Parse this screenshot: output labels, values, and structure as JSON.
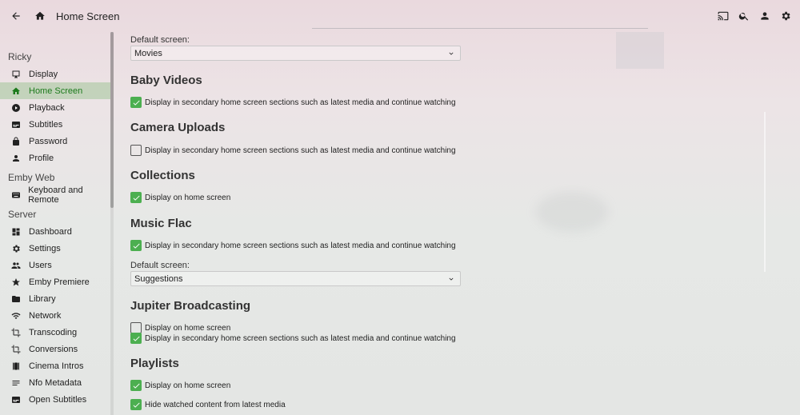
{
  "header": {
    "title": "Home Screen",
    "back_icon": "arrow-left-icon",
    "home_icon": "home-icon",
    "right_icons": [
      "cast-icon",
      "search-icon",
      "user-icon",
      "settings-gear-icon"
    ]
  },
  "sidebar": {
    "sections": [
      {
        "title": "Ricky",
        "items": [
          {
            "label": "Display",
            "icon": "monitor-icon"
          },
          {
            "label": "Home Screen",
            "icon": "home-icon",
            "active": true
          },
          {
            "label": "Playback",
            "icon": "play-circle-icon"
          },
          {
            "label": "Subtitles",
            "icon": "subtitles-icon"
          },
          {
            "label": "Password",
            "icon": "lock-icon"
          },
          {
            "label": "Profile",
            "icon": "person-icon"
          }
        ]
      },
      {
        "title": "Emby Web",
        "items": [
          {
            "label": "Keyboard and Remote",
            "icon": "keyboard-icon"
          }
        ]
      },
      {
        "title": "Server",
        "items": [
          {
            "label": "Dashboard",
            "icon": "dashboard-icon"
          },
          {
            "label": "Settings",
            "icon": "gear-icon"
          },
          {
            "label": "Users",
            "icon": "people-icon"
          },
          {
            "label": "Emby Premiere",
            "icon": "star-icon"
          },
          {
            "label": "Library",
            "icon": "folder-icon"
          },
          {
            "label": "Network",
            "icon": "wifi-icon"
          },
          {
            "label": "Transcoding",
            "icon": "crop-icon"
          },
          {
            "label": "Conversions",
            "icon": "crop-icon"
          },
          {
            "label": "Cinema Intros",
            "icon": "film-icon"
          },
          {
            "label": "Nfo Metadata",
            "icon": "list-icon"
          },
          {
            "label": "Open Subtitles",
            "icon": "subtitles-icon"
          }
        ]
      }
    ]
  },
  "main": {
    "default_screen_label": "Default screen:",
    "default_screen_value": "Movies",
    "libraries": {
      "baby_videos": {
        "title": "Baby Videos",
        "opt1": "Display in secondary home screen sections such as latest media and continue watching",
        "opt1_checked": true
      },
      "camera_uploads": {
        "title": "Camera Uploads",
        "opt1": "Display in secondary home screen sections such as latest media and continue watching",
        "opt1_checked": false
      },
      "collections": {
        "title": "Collections",
        "opt1": "Display on home screen",
        "opt1_checked": true
      },
      "music_flac": {
        "title": "Music Flac",
        "opt1": "Display in secondary home screen sections such as latest media and continue watching",
        "opt1_checked": true,
        "default_label": "Default screen:",
        "default_value": "Suggestions"
      },
      "jupiter": {
        "title": "Jupiter Broadcasting",
        "opt1": "Display on home screen",
        "opt1_checked": false,
        "opt2": "Display in secondary home screen sections such as latest media and continue watching",
        "opt2_checked": true
      },
      "playlists": {
        "title": "Playlists",
        "opt1": "Display on home screen",
        "opt1_checked": true,
        "opt2": "Hide watched content from latest media",
        "opt2_checked": true
      }
    }
  },
  "colors": {
    "accent": "#4caf50",
    "active_text": "#1c7a1c",
    "active_bg": "#b8d6ae"
  }
}
